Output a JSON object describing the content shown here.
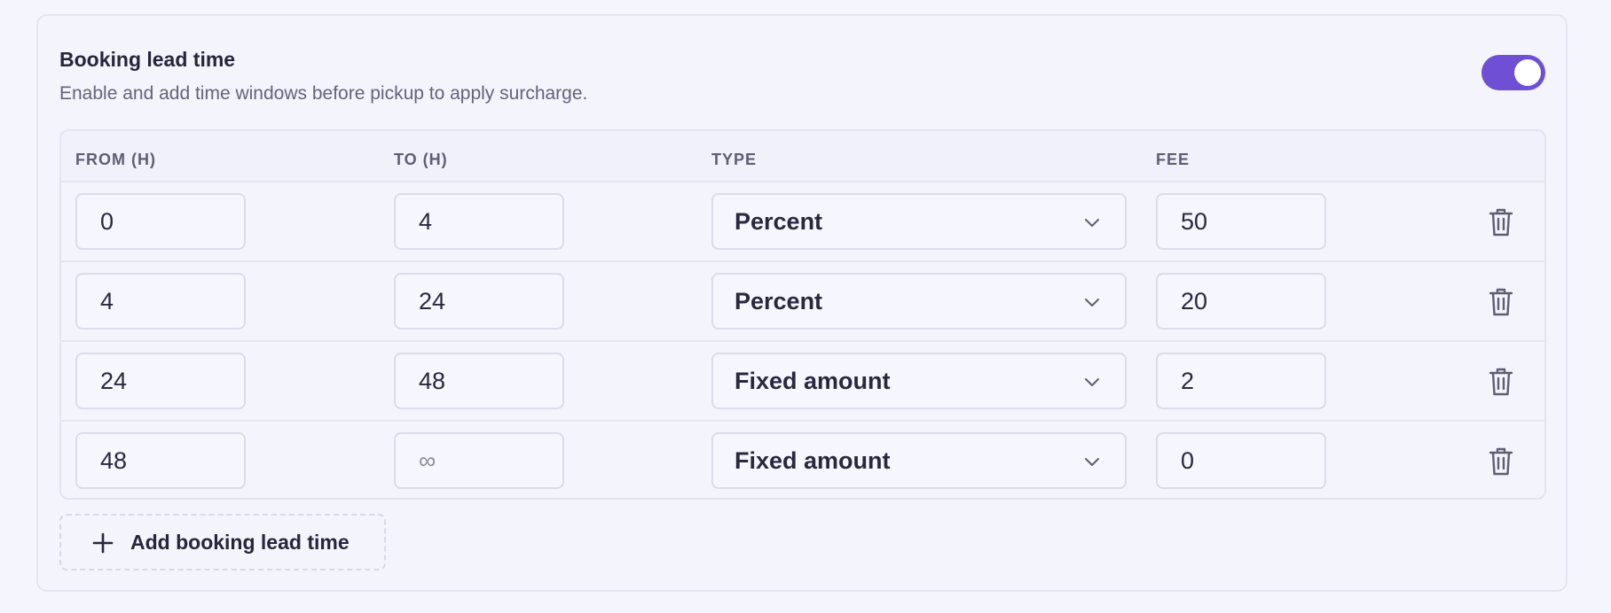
{
  "section": {
    "title": "Booking lead time",
    "description": "Enable and add time windows before pickup to apply surcharge.",
    "enabled": true
  },
  "colors": {
    "accent": "#6f4fd3",
    "background": "#f5f5fd",
    "border": "#e6e6f2"
  },
  "table": {
    "headers": [
      "FROM (H)",
      "TO (H)",
      "TYPE",
      "FEE"
    ],
    "rows": [
      {
        "from": "0",
        "to": "4",
        "to_placeholder": "",
        "type": "Percent",
        "fee": "50"
      },
      {
        "from": "4",
        "to": "24",
        "to_placeholder": "",
        "type": "Percent",
        "fee": "20"
      },
      {
        "from": "24",
        "to": "48",
        "to_placeholder": "",
        "type": "Fixed amount",
        "fee": "2"
      },
      {
        "from": "48",
        "to": "",
        "to_placeholder": "∞",
        "type": "Fixed amount",
        "fee": "0"
      }
    ]
  },
  "icons": {
    "toggle": "toggle-switch-icon",
    "select": "chevron-down-icon",
    "delete": "trash-icon",
    "add": "plus-icon"
  },
  "actions": {
    "add_label": "Add booking lead time"
  }
}
